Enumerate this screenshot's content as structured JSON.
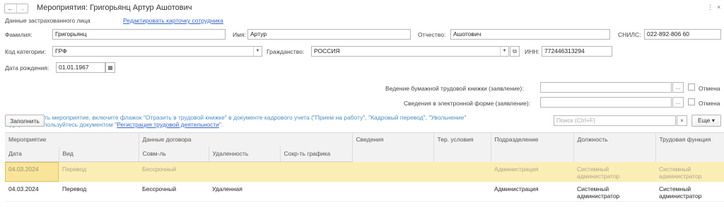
{
  "header": {
    "back_icon": "←",
    "forward_icon": "→",
    "title": "Мероприятия: Григорьянц Артур Ашотович",
    "more_icon": "⋮",
    "close_icon": "×"
  },
  "insured": {
    "label": "Данные застрахованного лица",
    "edit_link": "Редактировать карточку сотрудника"
  },
  "fields": {
    "surname_label": "Фамилия:",
    "surname": "Григорьянц",
    "name_label": "Имя:",
    "name": "Артур",
    "patronymic_label": "Отчество:",
    "patronymic": "Ашотович",
    "snils_label": "СНИЛС:",
    "snils": "022-892-806 60",
    "category_label": "Код категории:",
    "category": "ГРФ",
    "citizenship_label": "Гражданство:",
    "citizenship": "РОССИЯ",
    "inn_label": "ИНН:",
    "inn": "772446313294",
    "birth_label": "Дата рождения:",
    "birth": "01.01.1967",
    "paper_book_label": "Ведение бумажной трудовой книжки (заявление):",
    "paper_book": "",
    "electronic_label": "Сведения в электронной форме (заявление):",
    "electronic": "",
    "cancel_label_1": "Отмена",
    "cancel_label_2": "Отмена",
    "ellipsis": "..."
  },
  "info": {
    "line1": "Чтобы добавить мероприятие, включите флажок \"Отразить в трудовой книжке\" в документе кадрового учета (\"Прием на работу\", \"Кадровый перевод\", \"Увольнение\"",
    "line2_prefix": "и др.) или воспользуйтесь документом \"",
    "link": "Регистрация трудовой деятельности",
    "line2_suffix": "\"."
  },
  "toolbar": {
    "fill_button": "Заполнить",
    "search_placeholder": "Поиск (Ctrl+F)",
    "clear_icon": "×",
    "more_button": "Еще ▾"
  },
  "table": {
    "headers_top": [
      "Мероприятие",
      "Данные договора",
      "Сведения",
      "Тер. условия",
      "Подразделение",
      "Должность",
      "Трудовая функция"
    ],
    "headers_sub": [
      "Дата",
      "Вид",
      "Совм-ль",
      "Удаленность",
      "Сокр-ть графика"
    ],
    "rows": [
      {
        "date": "04.03.2024",
        "kind": "Перевод",
        "combo": "Бессрочный",
        "remote": "",
        "short": "",
        "info": "",
        "terr": "",
        "dept": "Администрация",
        "position": "Системный администратор",
        "function": "Системный администратор"
      },
      {
        "date": "04.03.2024",
        "kind": "Перевод",
        "combo": "Бессрочный",
        "remote": "Удаленная",
        "short": "",
        "info": "",
        "terr": "",
        "dept": "Администрация",
        "position": "Системный администратор",
        "function": "Системный администратор"
      }
    ]
  }
}
